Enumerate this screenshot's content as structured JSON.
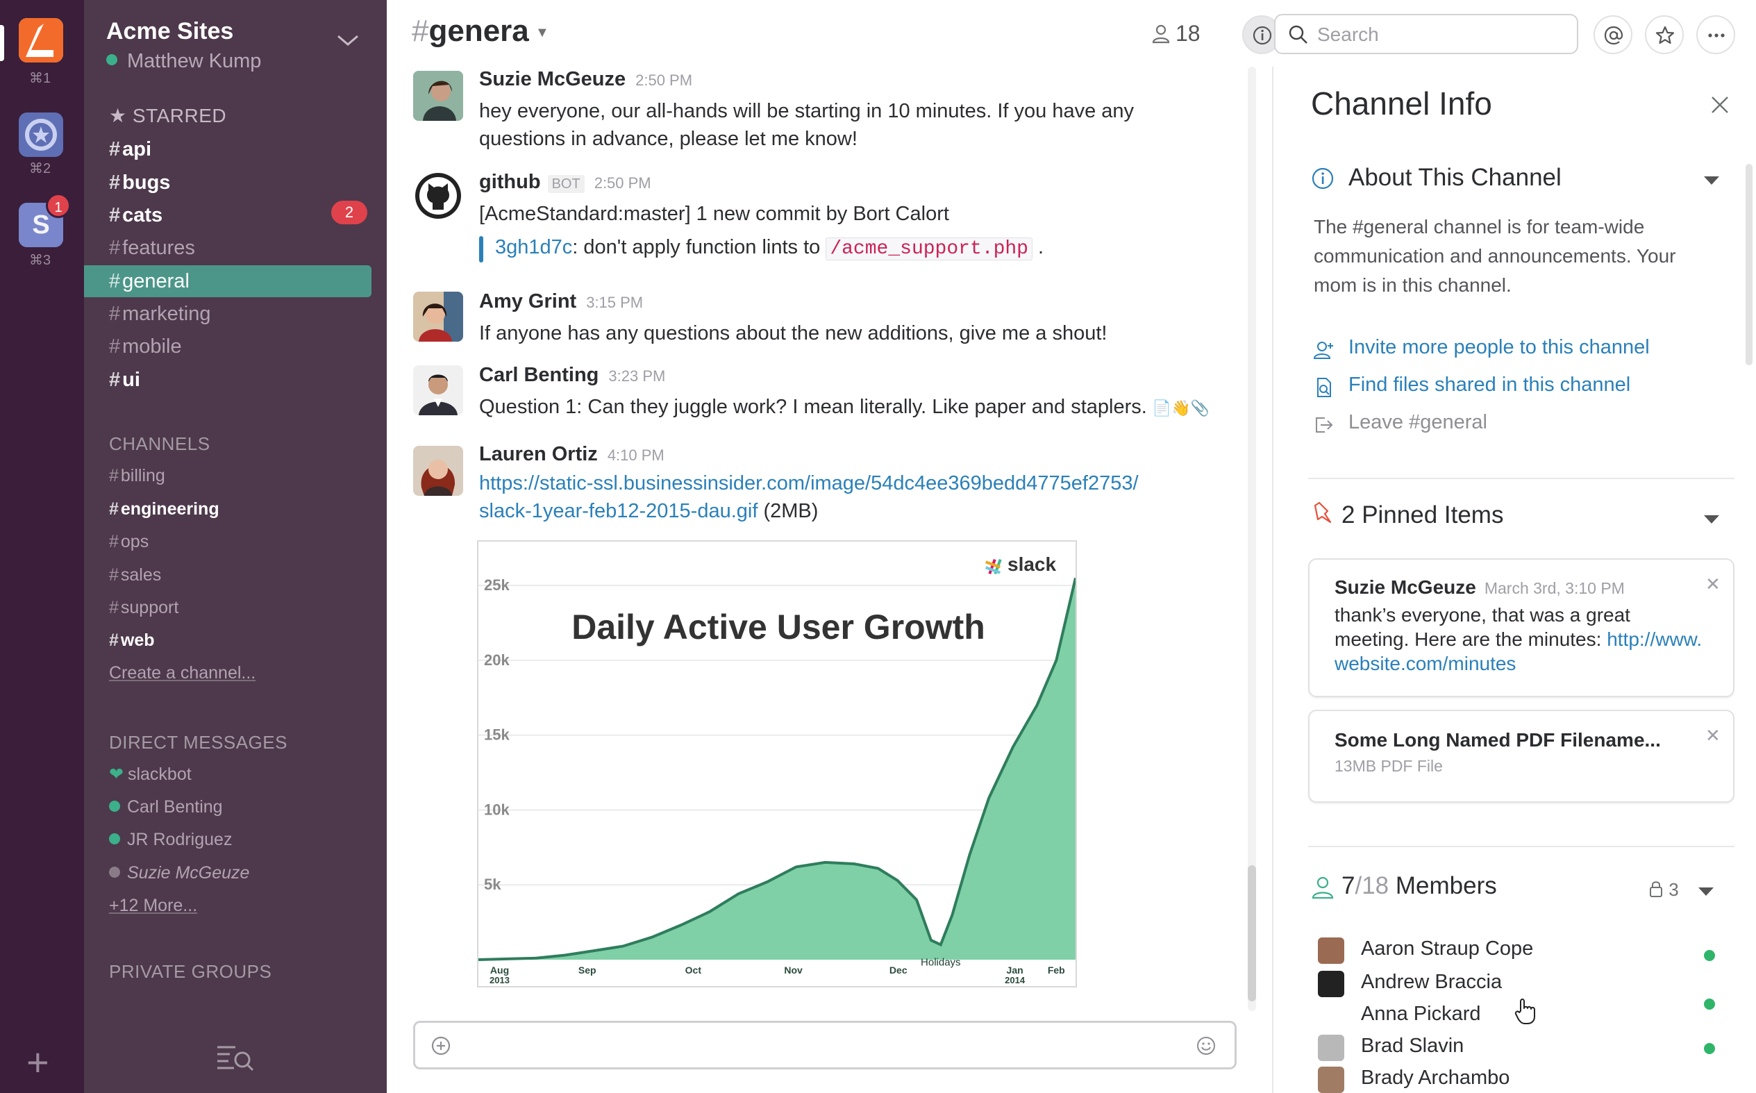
{
  "teams": [
    {
      "key": "⌘1",
      "active": true,
      "color": "#f5a623"
    },
    {
      "key": "⌘2",
      "active": false,
      "color": "#5f6fb5"
    },
    {
      "key": "⌘3",
      "active": false,
      "color": "#d6d6d6",
      "badge": "1",
      "letter": "S"
    }
  ],
  "sidebar": {
    "team_name": "Acme Sites",
    "user_name": "Matthew Kump",
    "starred_label": "STARRED",
    "starred": [
      {
        "name": "api",
        "bold": true
      },
      {
        "name": "bugs",
        "bold": true
      },
      {
        "name": "cats",
        "bold": true,
        "badge": "2"
      },
      {
        "name": "features",
        "bold": false
      },
      {
        "name": "general",
        "bold": false,
        "active": true
      },
      {
        "name": "marketing",
        "bold": false
      },
      {
        "name": "mobile",
        "bold": false
      },
      {
        "name": "ui",
        "bold": true
      }
    ],
    "channels_label": "CHANNELS",
    "channels": [
      {
        "name": "billing",
        "bold": false
      },
      {
        "name": "engineering",
        "bold": true
      },
      {
        "name": "ops",
        "bold": false
      },
      {
        "name": "sales",
        "bold": false
      },
      {
        "name": "support",
        "bold": false
      },
      {
        "name": "web",
        "bold": true
      }
    ],
    "create_channel": "Create a channel...",
    "dm_label": "DIRECT MESSAGES",
    "dms": [
      {
        "name": "slackbot"
      },
      {
        "name": "Carl Benting"
      },
      {
        "name": "JR Rodriguez"
      },
      {
        "name": "Suzie McGeuze"
      }
    ],
    "more_dms": "+12 More...",
    "private_label": "PRIVATE GROUPS"
  },
  "header": {
    "channel_hash": "#",
    "channel_name": "genera",
    "caret": "⌄",
    "member_count": "18",
    "search_placeholder": "Search"
  },
  "messages": [
    {
      "author": "Suzie McGeuze",
      "time": "2:50 PM",
      "text_1": "hey everyone, our all-hands will be starting in 10 minutes. If you have any",
      "text_2": "questions in advance, please let me know!"
    },
    {
      "author": "github",
      "bot": "BOT",
      "time": "2:50 PM",
      "text": "[AcmeStandard:master] 1 new commit by Bort Calort",
      "commit": "3gh1d7c",
      "commit_text": ": don't apply function lints to",
      "file": "/acme_support.php",
      "trail": " ."
    },
    {
      "author": "Amy Grint",
      "time": "3:15 PM",
      "text": "If anyone has any questions about the new additions, give me a shout!"
    },
    {
      "author": "Carl Benting",
      "time": "3:23 PM",
      "text": "Question 1: Can they juggle work? I mean literally. Like paper and staplers."
    },
    {
      "author": "Lauren Ortiz",
      "time": "4:10 PM",
      "link_1": "https://static-ssl.businessinsider.com/image/54dc4ee369bedd4775ef2753/",
      "link_2": "slack-1year-feb12-2015-dau.gif",
      "size": " (2MB)"
    }
  ],
  "chart_data": {
    "type": "area",
    "title": "Daily Active User Growth",
    "brand": "slack",
    "x_labels": [
      {
        "label": "Aug",
        "sub": "2013"
      },
      {
        "label": "Sep",
        "sub": ""
      },
      {
        "label": "Oct",
        "sub": ""
      },
      {
        "label": "Nov",
        "sub": ""
      },
      {
        "label": "Dec",
        "sub": ""
      },
      {
        "label": "Jan",
        "sub": "2014"
      },
      {
        "label": "Feb",
        "sub": ""
      }
    ],
    "y_ticks": [
      "25k",
      "20k",
      "15k",
      "10k",
      "5k"
    ],
    "y_tick_values": [
      25000,
      20000,
      15000,
      10000,
      5000
    ],
    "ylim": [
      0,
      27000
    ],
    "x_range": [
      0,
      6.2
    ],
    "points": [
      [
        0,
        0
      ],
      [
        0.3,
        50
      ],
      [
        0.6,
        100
      ],
      [
        0.9,
        300
      ],
      [
        1.2,
        600
      ],
      [
        1.5,
        900
      ],
      [
        1.8,
        1500
      ],
      [
        2.1,
        2300
      ],
      [
        2.4,
        3200
      ],
      [
        2.7,
        4400
      ],
      [
        3.0,
        5200
      ],
      [
        3.3,
        6200
      ],
      [
        3.6,
        6500
      ],
      [
        3.9,
        6400
      ],
      [
        4.15,
        6100
      ],
      [
        4.35,
        5300
      ],
      [
        4.55,
        4000
      ],
      [
        4.7,
        1300
      ],
      [
        4.8,
        1000
      ],
      [
        4.92,
        3000
      ],
      [
        5.1,
        7000
      ],
      [
        5.3,
        10800
      ],
      [
        5.55,
        14200
      ],
      [
        5.8,
        17000
      ],
      [
        6.0,
        20000
      ],
      [
        6.2,
        25500
      ]
    ],
    "annotation": {
      "text": "Holidays",
      "x": 4.8,
      "y": 1000
    },
    "fill_color": "#7fd0a7",
    "line_color": "#2f7d5c"
  },
  "composer": {
    "placeholder": ""
  },
  "panel": {
    "title": "Channel Info",
    "about_title": "About This Channel",
    "about_text": "The #general channel is for team-wide communication and announcements. Your mom is in this channel.",
    "actions": [
      {
        "label": "Invite more people to this channel"
      },
      {
        "label": "Find files shared in this channel"
      },
      {
        "label": "Leave #general"
      }
    ],
    "pinned_title": "2 Pinned Items",
    "pins": [
      {
        "author": "Suzie McGeuze",
        "date": "March 3rd, 3:10 PM",
        "text": "thank’s everyone, that was a great meeting. Here are the minutes: ",
        "link": "http://www.website.com/minutes",
        "close": "✕"
      },
      {
        "title": "Some Long Named PDF Filename...",
        "meta": "13MB PDF File",
        "close": "✕"
      }
    ],
    "members_online": "7",
    "members_total": "/18",
    "members_word": "Members",
    "locked_count": "3",
    "members": [
      {
        "name": "Aaron Straup Cope",
        "online": true
      },
      {
        "name": "Andrew Braccia",
        "online": true
      },
      {
        "name": "Anna Pickard",
        "online": false
      },
      {
        "name": "Brad Slavin",
        "online": true
      },
      {
        "name": "Brady Archambo",
        "online": true
      }
    ]
  },
  "colors": {
    "sidebar": "#4d394b",
    "switcher": "#3a1e3a",
    "active_channel": "#4c9689",
    "badge": "#e0424b",
    "link": "#2a80b9",
    "online": "#2fb569"
  }
}
